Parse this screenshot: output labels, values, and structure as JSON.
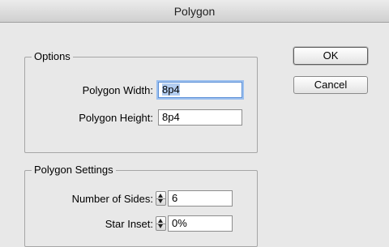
{
  "window": {
    "title": "Polygon"
  },
  "options": {
    "legend": "Options",
    "width_label": "Polygon Width:",
    "width_value": "8p4",
    "height_label": "Polygon Height:",
    "height_value": "8p4"
  },
  "settings": {
    "legend": "Polygon Settings",
    "sides_label": "Number of Sides:",
    "sides_value": "6",
    "inset_label": "Star Inset:",
    "inset_value": "0%"
  },
  "buttons": {
    "ok": "OK",
    "cancel": "Cancel"
  }
}
